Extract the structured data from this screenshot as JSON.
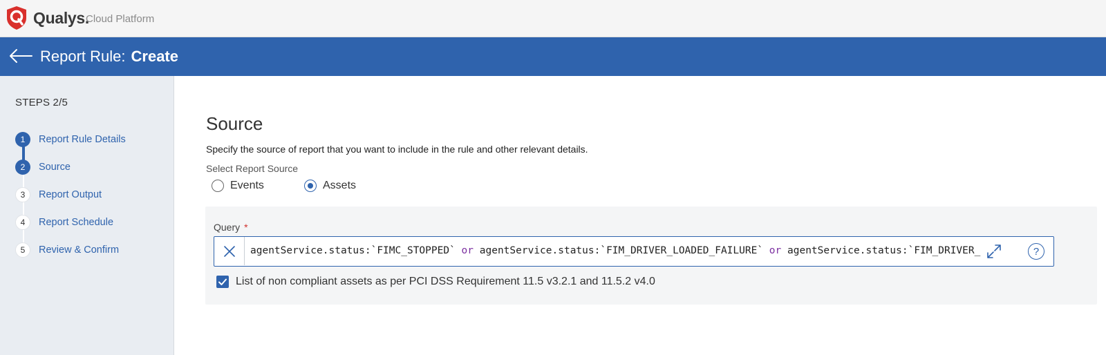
{
  "app": {
    "brand": "Qualys.",
    "brand_sub": "Cloud Platform"
  },
  "header": {
    "title_prefix": "Report Rule:",
    "title_mode": "Create"
  },
  "sidebar": {
    "steps_count": "STEPS 2/5",
    "steps": [
      {
        "number": "1",
        "label": "Report Rule Details",
        "state": "done"
      },
      {
        "number": "2",
        "label": "Source",
        "state": "current"
      },
      {
        "number": "3",
        "label": "Report Output",
        "state": "todo"
      },
      {
        "number": "4",
        "label": "Report Schedule",
        "state": "todo"
      },
      {
        "number": "5",
        "label": "Review & Confirm",
        "state": "todo"
      }
    ]
  },
  "main": {
    "title": "Source",
    "description": "Specify the source of report that you want to include in the rule and other relevant details.",
    "source_label": "Select Report Source",
    "source_options": [
      {
        "label": "Events",
        "selected": false
      },
      {
        "label": "Assets",
        "selected": true
      }
    ],
    "query": {
      "label": "Query",
      "required_mark": "*",
      "parts": [
        "agentService.status:`FIMC_STOPPED`",
        "or",
        "agentService.status:`FIM_DRIVER_LOADED_FAILURE`",
        "or",
        "agentService.status:`FIM_DRIVER_"
      ],
      "help_glyph": "?"
    },
    "checkbox": {
      "label": "List of non compliant assets as per PCI DSS Requirement 11.5 v3.2.1 and 11.5.2 v4.0",
      "checked": true
    }
  },
  "colors": {
    "primary": "#2f63ad",
    "keyword": "#7b2fa0",
    "required": "#d0312d",
    "logo_red": "#d9302c"
  }
}
